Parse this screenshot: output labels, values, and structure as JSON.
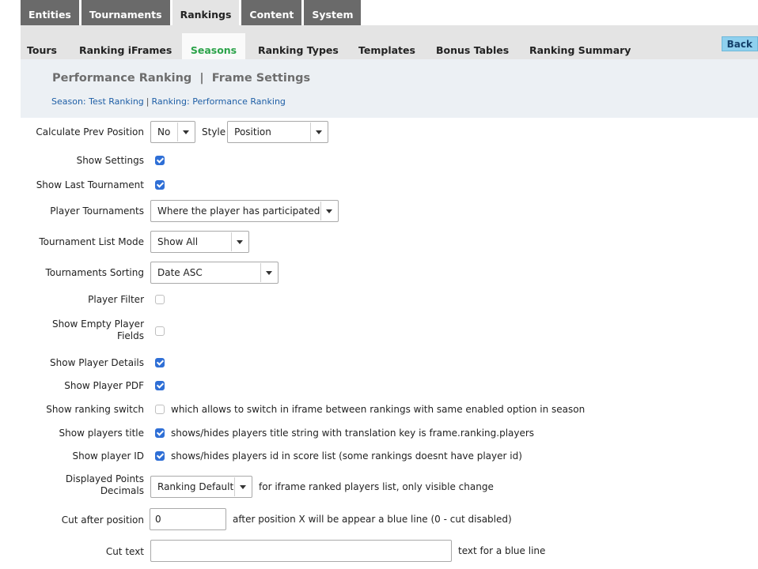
{
  "top_tabs": [
    "Entities",
    "Tournaments",
    "Rankings",
    "Content",
    "System"
  ],
  "subnav": {
    "items": [
      "Tours",
      "Ranking iFrames",
      "Seasons",
      "Ranking Types",
      "Templates",
      "Bonus Tables",
      "Ranking Summary"
    ],
    "active": "Seasons",
    "back_label": "Back"
  },
  "header": {
    "title": "Performance Ranking  |  Frame Settings",
    "crumb_season": "Season: Test Ranking",
    "crumb_sep": "|",
    "crumb_ranking": "Ranking: Performance Ranking"
  },
  "form": {
    "calc_prev_position": {
      "label": "Calculate Prev Position",
      "value": "No",
      "style_label": "Style",
      "style_value": "Position"
    },
    "show_settings": {
      "label": "Show Settings",
      "checked": true
    },
    "show_last_tournament": {
      "label": "Show Last Tournament",
      "checked": true
    },
    "player_tournaments": {
      "label": "Player Tournaments",
      "value": "Where the player has participated"
    },
    "tournament_list_mode": {
      "label": "Tournament List Mode",
      "value": "Show All"
    },
    "tournaments_sorting": {
      "label": "Tournaments Sorting",
      "value": "Date ASC"
    },
    "player_filter": {
      "label": "Player Filter",
      "checked": false
    },
    "show_empty_player_fields": {
      "label_line1": "Show Empty Player",
      "label_line2": "Fields",
      "checked": false
    },
    "show_player_details": {
      "label": "Show Player Details",
      "checked": true
    },
    "show_player_pdf": {
      "label": "Show Player PDF",
      "checked": true
    },
    "show_ranking_switch": {
      "label": "Show ranking switch",
      "checked": false,
      "note": "which allows to switch in iframe between rankings with same enabled option in season"
    },
    "show_players_title": {
      "label": "Show players title",
      "checked": true,
      "note": "shows/hides players title string with translation key is frame.ranking.players"
    },
    "show_player_id": {
      "label": "Show player ID",
      "checked": true,
      "note": "shows/hides players id in score list (some rankings doesnt have player id)"
    },
    "displayed_points_decimals": {
      "label_line1": "Displayed Points",
      "label_line2": "Decimals",
      "value": "Ranking Default",
      "note": "for iframe ranked players list, only visible change"
    },
    "cut_after_position": {
      "label": "Cut after position",
      "value": "0",
      "note": "after position X will be appear a blue line (0 - cut disabled)"
    },
    "cut_text": {
      "label": "Cut text",
      "value": "",
      "note": "text for a blue line"
    }
  },
  "colors": {
    "active_tab_text": "#2ca34a",
    "checkbox_on": "#2f6fd6",
    "back_button": "#8fd0ee",
    "link": "#1f5fa6"
  }
}
